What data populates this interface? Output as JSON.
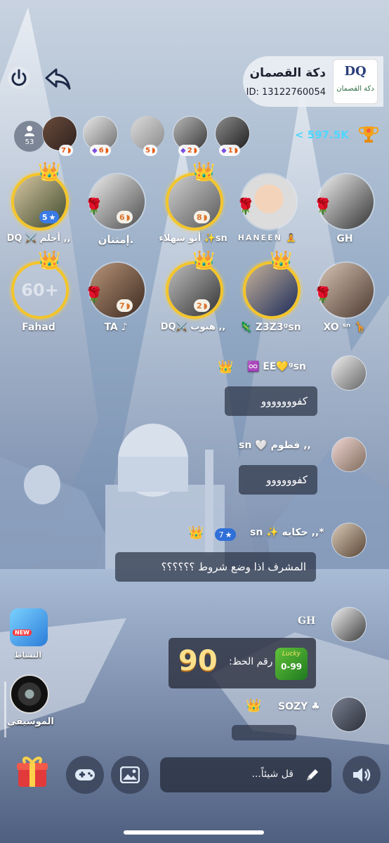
{
  "room": {
    "name": "دكة القصمان",
    "id_text": "ID: 13122760054",
    "logo_text": "دكة القصمان",
    "logo_initials": "DQ"
  },
  "header": {
    "online_count": "53",
    "score": "< 597.5K"
  },
  "top_users": [
    {
      "badge": "7"
    },
    {
      "badge": "6"
    },
    {
      "badge": "5"
    },
    {
      "badge": "2"
    },
    {
      "badge": "1"
    }
  ],
  "seats_row1": [
    {
      "name": "GH",
      "level": ""
    },
    {
      "name": "HANEEN 🧘",
      "level": ""
    },
    {
      "name": "أبو شهلاء ✨sn",
      "level": "8"
    },
    {
      "name": "إمتنان.",
      "level": "6"
    },
    {
      "name": "DQ ⚔️ أحلم ,,",
      "level": "5"
    }
  ],
  "seats_row2": [
    {
      "name": "XO ˢⁿ 🦒",
      "level": ""
    },
    {
      "name": "🦎 Z3Z3ᵍsn",
      "level": ""
    },
    {
      "name": "DQ⚔️ هبوب ,,",
      "level": "2"
    },
    {
      "name": "TA ♪",
      "level": "7"
    },
    {
      "name": "Fahad",
      "level": "",
      "placeholder": "60+"
    }
  ],
  "chat": [
    {
      "name": "♾️ EE💛ᵍsn",
      "text": "كفووووووو"
    },
    {
      "name": "sn 🤍 فطوم ,,",
      "text": "كفوووووو"
    },
    {
      "name": "sn ✨ حكايه ,,*",
      "badge": "7",
      "text": "المشرف اذا وضع شروط ؟؟؟؟؟؟"
    },
    {
      "name": "GH",
      "lucky_label": "رقم الحظ:",
      "lucky_number": "90",
      "lucky_range": "0-99",
      "lucky_tag": "Lucky"
    },
    {
      "name": "SOZY ♣",
      "text": ""
    }
  ],
  "side": {
    "activity_label": "النشاط",
    "activity_tag": "NEW",
    "music_label": "الموسيقى"
  },
  "bottom": {
    "input_placeholder": "قل شيئاً..."
  }
}
